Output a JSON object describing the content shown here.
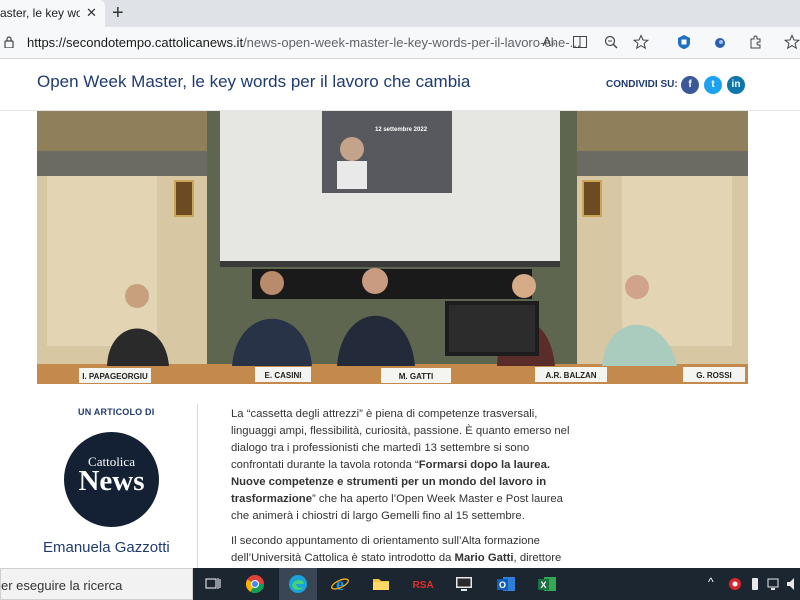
{
  "browser": {
    "tab_title": "aster, le key words",
    "url_domain": "https://secondotempo.cattolicanews.it",
    "url_path": "/news-open-week-master-le-key-words-per-il-lavoro-che-..."
  },
  "header": {
    "title": "Open Week Master, le key words per il lavoro che cambia",
    "share_label": "CONDIVIDI SU:",
    "social": [
      "f",
      "t",
      "in"
    ]
  },
  "photo": {
    "nameplates": [
      "I. PAPAGEORGIU",
      "E. CASINI",
      "M. GATTI",
      "A.R. BALZAN",
      "G. ROSSI"
    ],
    "screen_date": "12 settembre 2022"
  },
  "byline": {
    "label": "UN ARTICOLO DI",
    "logo_top": "Cattolica",
    "logo_main": "News",
    "author": "Emanuela Gazzotti"
  },
  "article": {
    "p1_part1": "La “cassetta degli attrezzi” è piena di competenze trasversali, linguaggi ampi, flessibilità, curiosità, passione. È quanto emerso nel dialogo tra i professionisti che martedì 13 settembre si sono confrontati durante la tavola rotonda “",
    "p1_bold": "Formarsi dopo la laurea. Nuove competenze e strumenti per un mondo del lavoro in trasformazione",
    "p1_part2": "” che ha aperto l’Open Week Master e Post laurea che animerà i chiostri di largo Gemelli fino al 15 settembre.",
    "p2_part1": "Il secondo appuntamento di orientamento sull’Alta formazione dell’Università Cattolica è stato introdotto da ",
    "p2_bold": "Mario Gatti",
    "p2_part2": ", direttore"
  },
  "taskbar": {
    "search_text": "er eseguire la ricerca"
  },
  "colors": {
    "title": "#1f3b6e",
    "facebook": "#3b5998",
    "twitter": "#1da1f2",
    "linkedin": "#0e76a8",
    "logo_bg": "#142033"
  }
}
